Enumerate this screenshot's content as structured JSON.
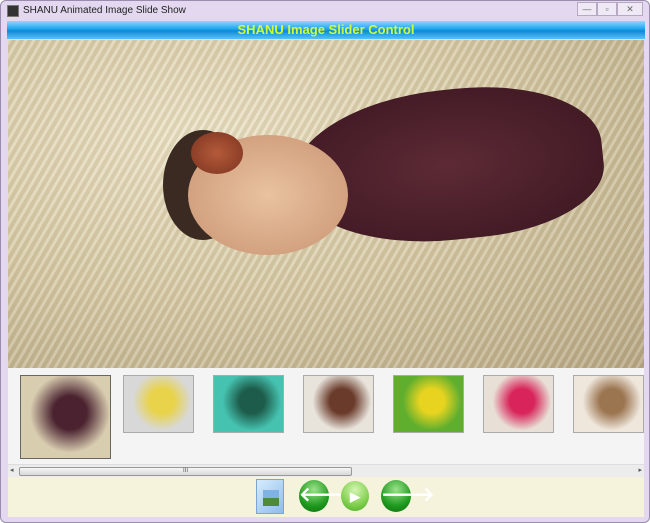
{
  "window": {
    "title": "SHANU Animated Image Slide Show",
    "minimize": "—",
    "maximize": "▫",
    "close": "✕"
  },
  "header": {
    "title": "SHANU Image Slider Control"
  },
  "thumbnails": [
    {
      "name": "baby-on-fur",
      "selected": true,
      "colors": [
        "#d9cdb0",
        "#4a2230"
      ]
    },
    {
      "name": "made-in-korea",
      "selected": false,
      "colors": [
        "#d8d8d8",
        "#e8d34a"
      ]
    },
    {
      "name": "kaleidoscope",
      "selected": false,
      "colors": [
        "#46c2b0",
        "#1d5b4a"
      ]
    },
    {
      "name": "boy-on-toy-car",
      "selected": false,
      "colors": [
        "#e8e4dc",
        "#6a3a2a"
      ]
    },
    {
      "name": "boy-in-flowers",
      "selected": false,
      "colors": [
        "#5fae2e",
        "#e8d420"
      ]
    },
    {
      "name": "girl-pink-floor",
      "selected": false,
      "colors": [
        "#e8e0d6",
        "#d8245a"
      ]
    },
    {
      "name": "baby-in-basket",
      "selected": false,
      "colors": [
        "#efe7dc",
        "#9b7550"
      ]
    }
  ],
  "scrollbar": {
    "grip": "III",
    "left": "◂",
    "right": "▸",
    "position": 0
  },
  "controls": {
    "folder": "open-folder",
    "prev": "🡐",
    "play": "▶",
    "next": "🡒"
  }
}
